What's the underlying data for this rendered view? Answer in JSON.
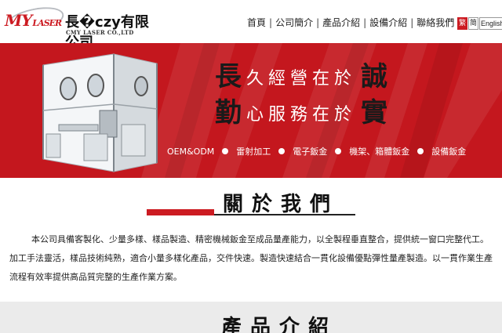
{
  "header": {
    "logo_mark": "MY",
    "logo_mark_suffix": "LASER",
    "company_name_cn": "長�czy有限公司",
    "company_name_en": "CMY LASER CO.,LTD"
  },
  "nav": {
    "items": [
      {
        "label": "首頁"
      },
      {
        "label": "公司簡介"
      },
      {
        "label": "產品介紹"
      },
      {
        "label": "設備介紹"
      },
      {
        "label": "聯絡我們"
      }
    ],
    "separator": "|"
  },
  "language": {
    "options": [
      {
        "label": "繁"
      },
      {
        "label": "简"
      },
      {
        "label": "English"
      }
    ]
  },
  "banner": {
    "line1_first": "長",
    "line1_middle": "久經營在於",
    "line1_last": "誠",
    "line2_first": "勤",
    "line2_middle": "心服務在於",
    "line2_last": "實",
    "services": [
      "OEM&ODM",
      "雷射加工",
      "電子鈑金",
      "機架、箱體鈑金",
      "設備鈑金"
    ],
    "background_color": "#c4171e"
  },
  "about": {
    "title": "關於我們",
    "body": "本公司具備客製化、少量多樣、樣品製造、精密機械鈑金至成品量產能力，以全製程垂直整合，提供統一窗口完整代工。加工手法靈活，樣品技術純熟，適合小量多樣化產品，交件快速。製造快速結合一貫化設備優點彈性量產製造。以一貫作業生產流程有效率提供高品質完整的生產作業方案。"
  },
  "products": {
    "title": "產品介紹"
  }
}
